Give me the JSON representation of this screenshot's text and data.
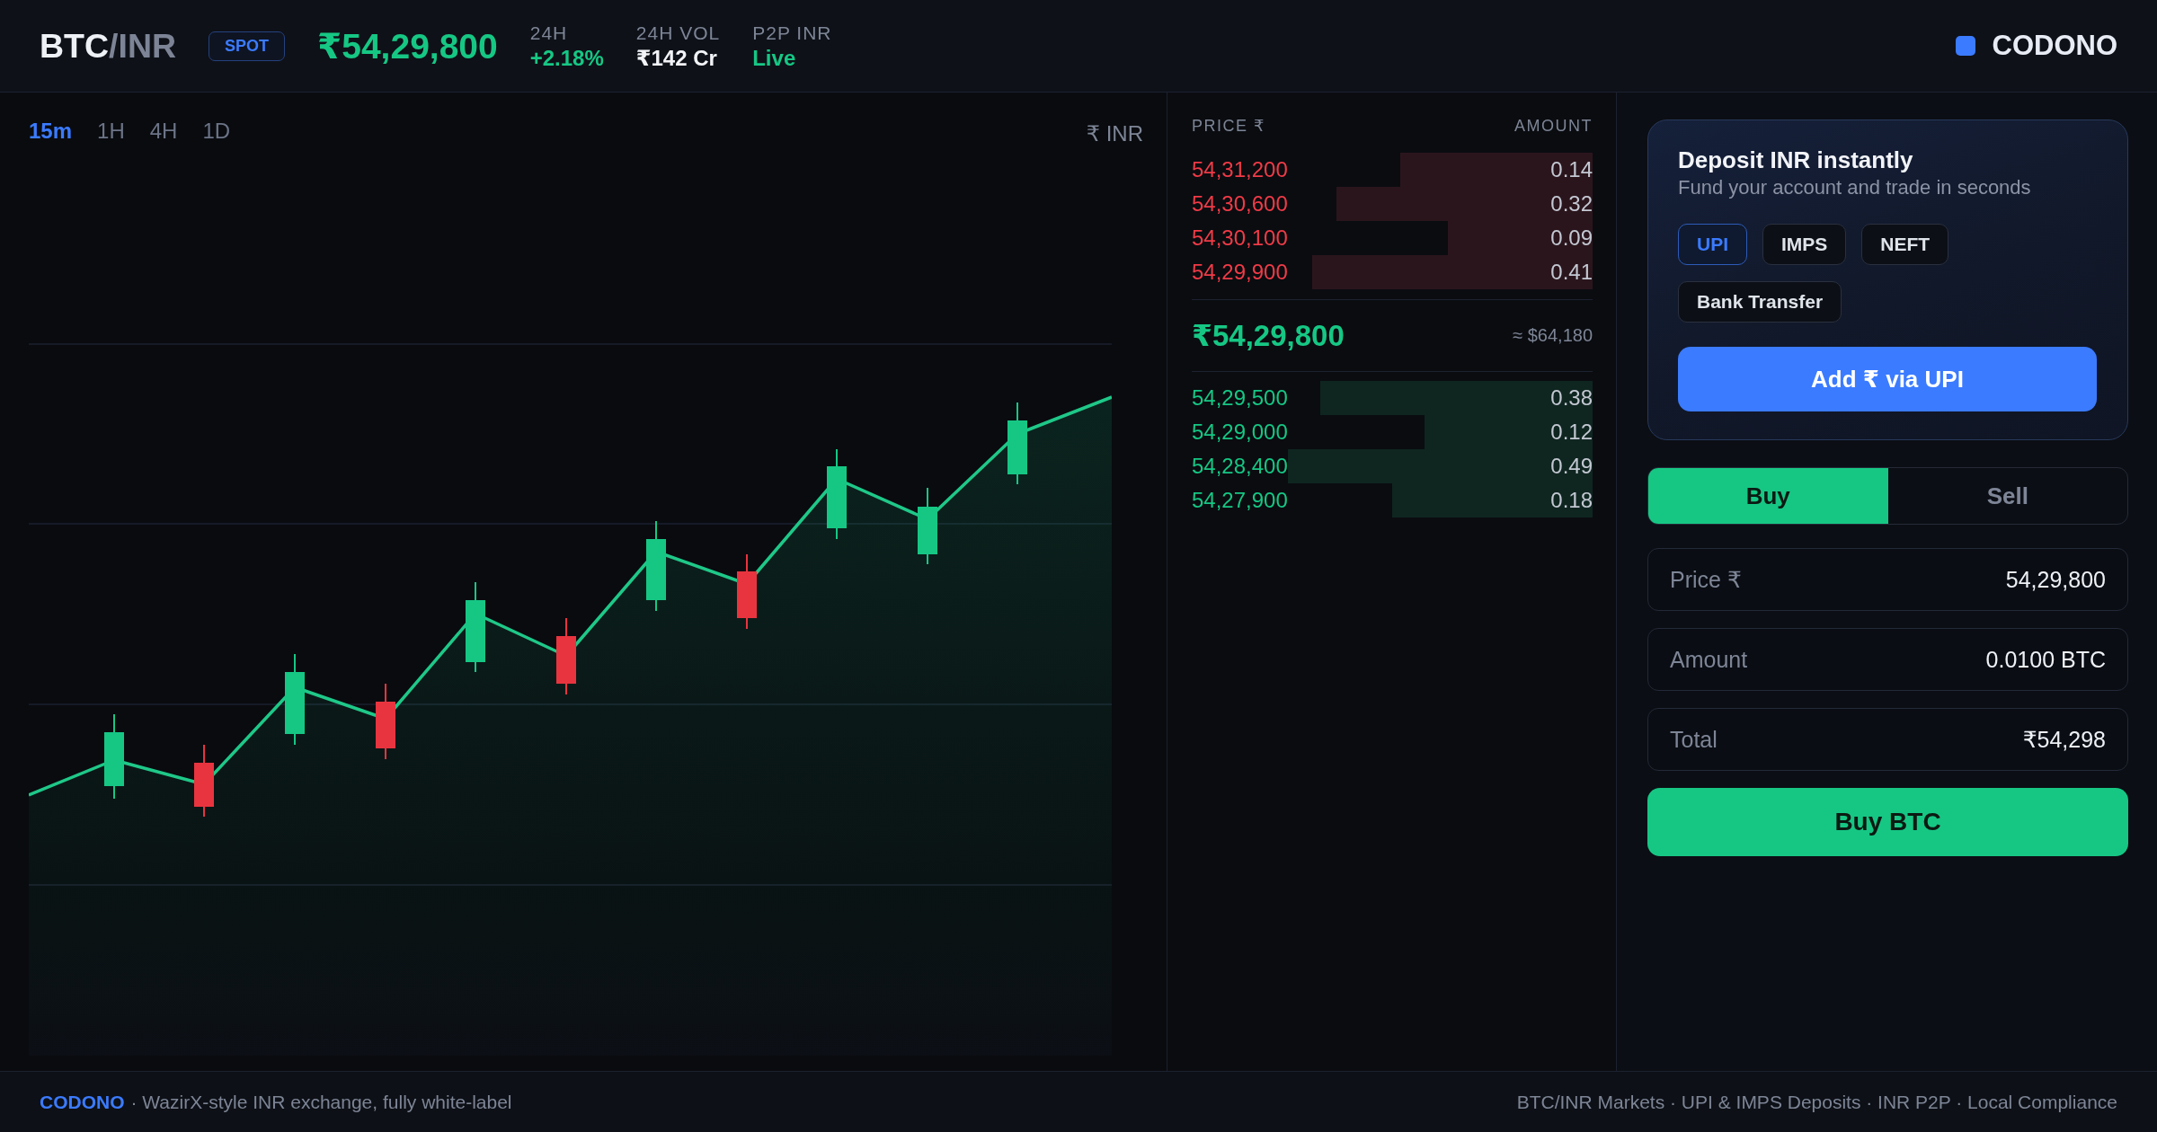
{
  "header": {
    "pair_base": "BTC",
    "pair_quote": "/INR",
    "market_badge": "SPOT",
    "last_price": "₹54,29,800",
    "stats": [
      {
        "label": "24H",
        "value": "+2.18%",
        "kind": "up"
      },
      {
        "label": "24H VOL",
        "value": "₹142 Cr",
        "kind": "plain"
      },
      {
        "label": "P2P INR",
        "value": "Live",
        "kind": "up"
      }
    ],
    "brand": "CODONO"
  },
  "chart": {
    "timeframes": [
      {
        "label": "15m",
        "selected": true
      },
      {
        "label": "1H",
        "selected": false
      },
      {
        "label": "4H",
        "selected": false
      },
      {
        "label": "1D",
        "selected": false
      }
    ],
    "currency": "₹ INR"
  },
  "order_book": {
    "columns": [
      "PRICE ₹",
      "AMOUNT"
    ],
    "asks": [
      {
        "price": "54,31,200",
        "amount": "0.14",
        "level": 0.48
      },
      {
        "price": "54,30,600",
        "amount": "0.32",
        "level": 0.64
      },
      {
        "price": "54,30,100",
        "amount": "0.09",
        "level": 0.36
      },
      {
        "price": "54,29,900",
        "amount": "0.41",
        "level": 0.7
      }
    ],
    "mid_price": "₹54,29,800",
    "mid_price_usd": "≈ $64,180",
    "bids": [
      {
        "price": "54,29,500",
        "amount": "0.38",
        "level": 0.68
      },
      {
        "price": "54,29,000",
        "amount": "0.12",
        "level": 0.42
      },
      {
        "price": "54,28,400",
        "amount": "0.49",
        "level": 0.76
      },
      {
        "price": "54,27,900",
        "amount": "0.18",
        "level": 0.5
      }
    ]
  },
  "deposit": {
    "title": "Deposit INR instantly",
    "subtitle": "Fund your account and trade in seconds",
    "methods": [
      {
        "label": "UPI",
        "selected": true
      },
      {
        "label": "IMPS",
        "selected": false
      },
      {
        "label": "NEFT",
        "selected": false
      },
      {
        "label": "Bank Transfer",
        "selected": false
      }
    ],
    "action": "Add ₹ via UPI"
  },
  "order_form": {
    "sides": [
      {
        "label": "Buy",
        "selected": true
      },
      {
        "label": "Sell",
        "selected": false
      }
    ],
    "fields": [
      {
        "label": "Price ₹",
        "value": "54,29,800"
      },
      {
        "label": "Amount",
        "value": "0.0100 BTC"
      },
      {
        "label": "Total",
        "value": "₹54,298"
      }
    ],
    "submit": "Buy BTC"
  },
  "footer": {
    "brand": "CODONO",
    "tagline": "· WazirX-style INR exchange, fully white-label",
    "features": "BTC/INR Markets · UPI & IMPS Deposits · INR P2P · Local Compliance"
  }
}
